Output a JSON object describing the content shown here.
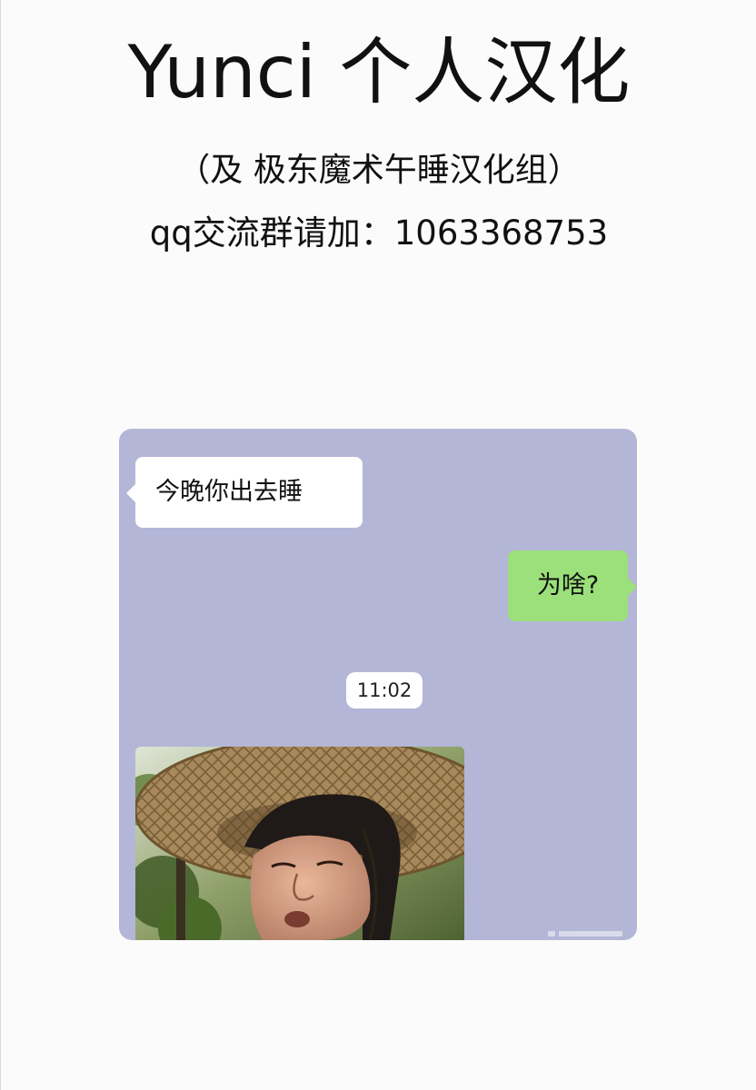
{
  "header": {
    "title": "Yunci 个人汉化",
    "subtitle": "（及 极东魔术午睡汉化组）",
    "qq_line": "qq交流群请加：1063368753"
  },
  "chat": {
    "background": "#b3b6d6",
    "messages": [
      {
        "side": "left",
        "text": "今晚你出去睡"
      },
      {
        "side": "right",
        "text": "为啥?"
      }
    ],
    "timestamp": "11:02",
    "photo_icon": "straw-hat-man-photo"
  },
  "colors": {
    "left_bubble": "#ffffff",
    "right_bubble": "#9be07a",
    "page_bg": "#fbfbfb"
  }
}
